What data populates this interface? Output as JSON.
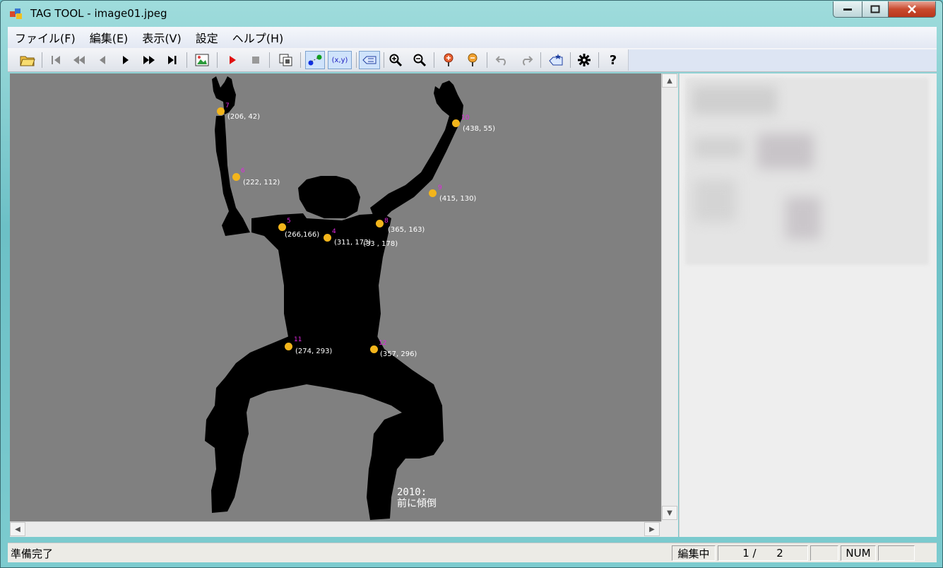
{
  "window": {
    "app_name": "TAG TOOL",
    "file_title": " - image01.jpeg"
  },
  "menu": [
    {
      "label": "ファイル(F)"
    },
    {
      "label": "編集(E)"
    },
    {
      "label": "表示(V)"
    },
    {
      "label": "設定"
    },
    {
      "label": "ヘルプ(H)"
    }
  ],
  "toolbar": {
    "open_icon": "folder-open-icon",
    "first_icon": "skip-first-icon",
    "rewind_icon": "rewind-icon",
    "prev_icon": "step-back-icon",
    "play_icon": "play-icon",
    "fast_forward_icon": "fast-forward-icon",
    "last_icon": "skip-last-icon",
    "image_icon": "image-icon",
    "record_icon": "record-icon",
    "stop_icon": "stop-icon",
    "frames_icon": "frames-icon",
    "points_icon": "points-icon",
    "coords_label": "(x,y)",
    "tag_icon": "tag-icon",
    "zoom_in_icon": "zoom-in-icon",
    "zoom_out_icon": "zoom-out-icon",
    "marker_add_icon": "marker-add-icon",
    "marker_remove_icon": "marker-remove-icon",
    "undo_icon": "undo-icon",
    "redo_icon": "redo-icon",
    "label_icon": "label-add-icon",
    "settings_icon": "gear-icon",
    "help_icon": "help-icon",
    "colors": {
      "record": "#e01010",
      "points_blue": "#1030e0",
      "points_green": "#10a020"
    }
  },
  "keypoints": [
    {
      "index": "7",
      "coord": "(206, 42)"
    },
    {
      "index": "6",
      "coord": "(222, 112)"
    },
    {
      "index": "5",
      "coord": "(266,166)"
    },
    {
      "index": "4",
      "coord": "(311, 173)"
    },
    {
      "index": "8",
      "coord": "(365, 163)"
    },
    {
      "index": "9",
      "coord": "(415, 130)"
    },
    {
      "index": "10",
      "coord": "(438, 55)"
    },
    {
      "index": "11",
      "coord": "(274, 293)"
    },
    {
      "index": "12",
      "coord": "(357, 296)"
    }
  ],
  "overlay_extra": "(33 , 178)",
  "caption": {
    "line1": "2010:",
    "line2": "前に傾倒"
  },
  "status": {
    "text": "準備完了",
    "mode": "編集中",
    "page": "1 /      2",
    "num": "NUM"
  }
}
